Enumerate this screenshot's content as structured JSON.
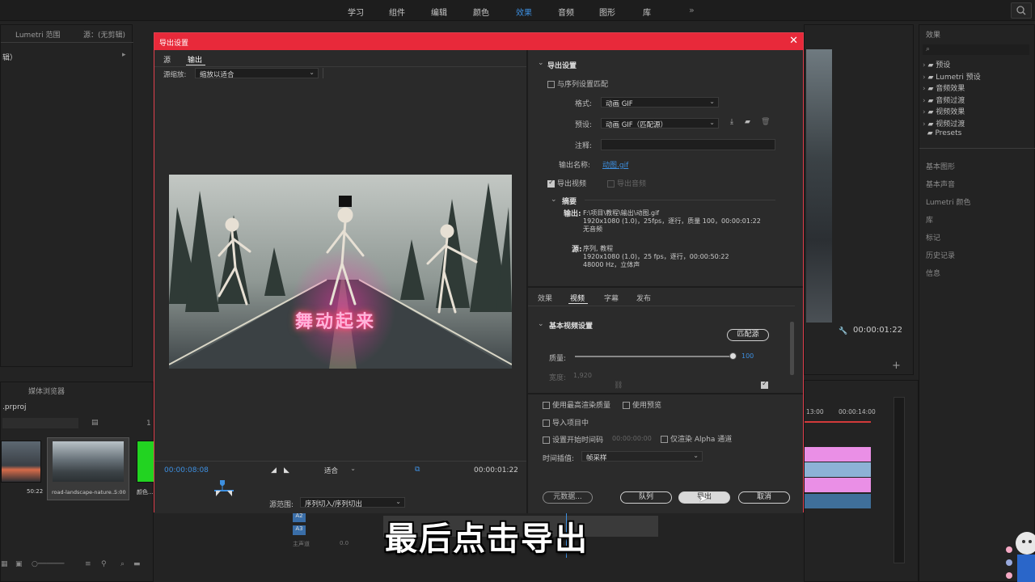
{
  "workspace": {
    "tabs": [
      {
        "label": "学习"
      },
      {
        "label": "组件"
      },
      {
        "label": "编辑"
      },
      {
        "label": "颜色"
      },
      {
        "label": "效果"
      },
      {
        "label": "音频"
      },
      {
        "label": "图形"
      },
      {
        "label": "库"
      }
    ],
    "active_tab": "效果",
    "more": "»"
  },
  "left_panel": {
    "tab_lumetri": "Lumetri 范围",
    "tab_source": "源：(无剪辑)",
    "row_label": "辑）",
    "bottom_tab": "媒体浏览器",
    "project_file": ".prproj",
    "page_num": "1",
    "clips": [
      {
        "label": "",
        "duration": "50:22"
      },
      {
        "label": "road-landscape-nature...",
        "duration": "5:00"
      },
      {
        "label": "颜色...",
        "duration": ""
      }
    ]
  },
  "effects_panel": {
    "title": "效果",
    "tree": [
      {
        "label": "预设"
      },
      {
        "label": "Lumetri 预设"
      },
      {
        "label": "音频效果"
      },
      {
        "label": "音频过渡"
      },
      {
        "label": "视频效果"
      },
      {
        "label": "视频过渡"
      },
      {
        "label": "Presets"
      }
    ],
    "sections": [
      {
        "label": "基本图形"
      },
      {
        "label": "基本声音"
      },
      {
        "label": "Lumetri 颜色"
      },
      {
        "label": "库"
      },
      {
        "label": "标记"
      },
      {
        "label": "历史记录"
      },
      {
        "label": "信息"
      }
    ]
  },
  "program_monitor": {
    "timecode": "00:00:01:22"
  },
  "timeline": {
    "ruler": [
      "13:00",
      "00:00:14:00"
    ],
    "tracks": [
      {
        "label": "A2"
      },
      {
        "label": "A3"
      },
      {
        "label": "主声道"
      }
    ],
    "master_value": "0.0"
  },
  "dialog": {
    "title": "导出设置",
    "close": "✕",
    "left": {
      "tabs": [
        {
          "label": "源"
        },
        {
          "label": "输出"
        }
      ],
      "active_tab": "输出",
      "source_scale_label": "源缩放:",
      "source_scale_value": "缩放以适合",
      "preview_text": "舞动起来",
      "current_time": "00:00:08:08",
      "fit_value": "适合",
      "end_time": "00:00:01:22",
      "range_label": "源范围:",
      "range_value": "序列切入/序列切出"
    },
    "export_settings": {
      "section_title": "导出设置",
      "match_sequence": "与序列设置匹配",
      "format_label": "格式:",
      "format_value": "动画 GIF",
      "preset_label": "预设:",
      "preset_value": "动画 GIF（匹配源）",
      "comment_label": "注释:",
      "output_name_label": "输出名称:",
      "output_name_value": "动图.gif",
      "export_video": "导出视频",
      "export_audio": "导出音频",
      "summary_title": "摘要",
      "output_key": "输出:",
      "output_path": "F:\\项目\\教程\\输出\\动图.gif",
      "output_line2": "1920x1080 (1.0)，25fps，逐行，质量 100，00:00:01:22",
      "output_line3": "无音频",
      "source_key": "源:",
      "source_name": "序列, 教程",
      "source_line2": "1920x1080 (1.0)，25 fps，逐行，00:00:50:22",
      "source_line3": "48000 Hz，立体声"
    },
    "tabs2": [
      {
        "label": "效果"
      },
      {
        "label": "视频"
      },
      {
        "label": "字幕"
      },
      {
        "label": "发布"
      }
    ],
    "active_tab2": "视频",
    "video": {
      "section_title": "基本视频设置",
      "match_source_btn": "匹配源",
      "quality_label": "质量:",
      "quality_value": "100",
      "quality_fraction": 1.0,
      "width_label": "宽度:",
      "width_value": "1,920"
    },
    "options": {
      "max_render": "使用最高渲染质量",
      "use_preview": "使用预览",
      "import_project": "导入项目中",
      "set_timecode": "设置开始时间码",
      "timecode_value": "00:00:00:00",
      "render_alpha": "仅渲染 Alpha 通道",
      "interp_label": "时间插值:",
      "interp_value": "帧采样"
    },
    "buttons": {
      "metadata": "元数据...",
      "queue": "队列",
      "export": "导出",
      "cancel": "取消"
    }
  },
  "subtitle": "最后点击导出"
}
